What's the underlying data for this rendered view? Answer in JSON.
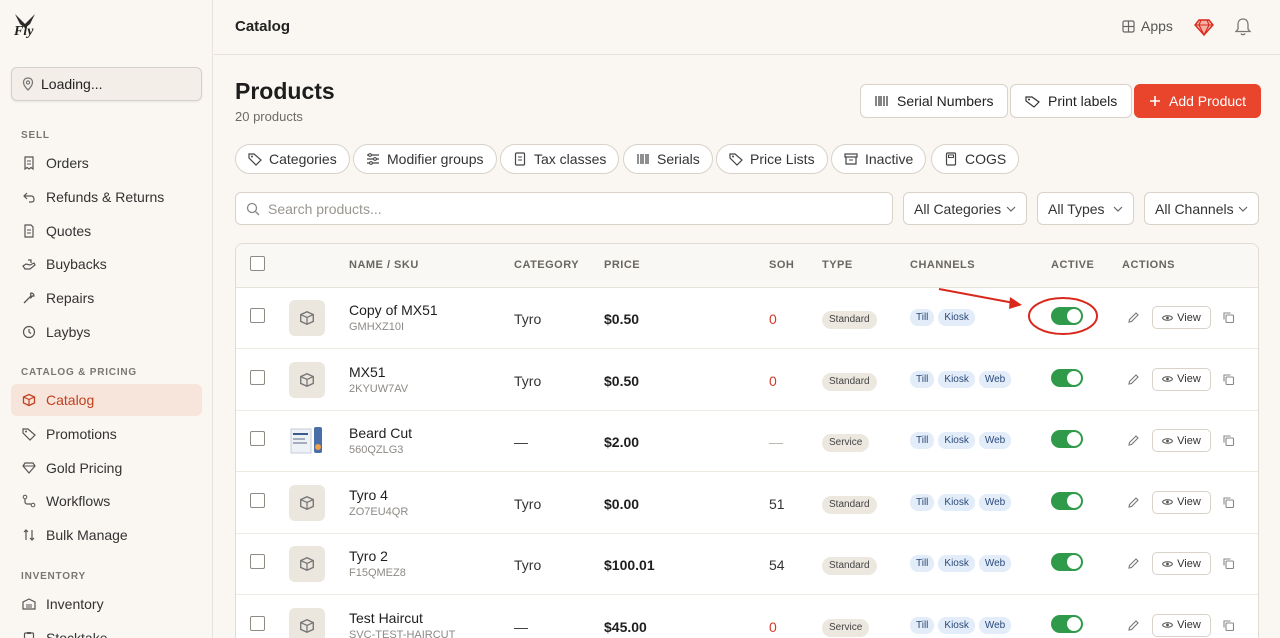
{
  "app": {
    "logo_text": "Fly"
  },
  "sidebar": {
    "location": "Loading...",
    "sections": [
      {
        "label": "SELL",
        "items": [
          {
            "label": "Orders",
            "icon": "receipt-icon"
          },
          {
            "label": "Refunds & Returns",
            "icon": "return-arrow-icon"
          },
          {
            "label": "Quotes",
            "icon": "document-icon"
          },
          {
            "label": "Buybacks",
            "icon": "hand-icon"
          },
          {
            "label": "Repairs",
            "icon": "wrench-icon"
          },
          {
            "label": "Laybys",
            "icon": "clock-icon"
          }
        ]
      },
      {
        "label": "CATALOG & PRICING",
        "items": [
          {
            "label": "Catalog",
            "icon": "box-icon",
            "active": true
          },
          {
            "label": "Promotions",
            "icon": "tag-icon"
          },
          {
            "label": "Gold Pricing",
            "icon": "gem-icon"
          },
          {
            "label": "Workflows",
            "icon": "workflow-icon"
          },
          {
            "label": "Bulk Manage",
            "icon": "sort-arrows-icon"
          }
        ]
      },
      {
        "label": "INVENTORY",
        "items": [
          {
            "label": "Inventory",
            "icon": "warehouse-icon"
          },
          {
            "label": "Stocktake",
            "icon": "clipboard-icon"
          }
        ]
      }
    ]
  },
  "header": {
    "title": "Catalog",
    "apps_label": "Apps"
  },
  "page": {
    "title": "Products",
    "subtitle": "20 products",
    "buttons": {
      "serial_numbers": "Serial Numbers",
      "print_labels": "Print labels",
      "add_product": "Add Product"
    },
    "chips": [
      "Categories",
      "Modifier groups",
      "Tax classes",
      "Serials",
      "Price Lists",
      "Inactive",
      "COGS"
    ],
    "search_placeholder": "Search products...",
    "filters": {
      "categories": "All Categories",
      "types": "All Types",
      "channels": "All Channels"
    }
  },
  "table": {
    "headers": {
      "name": "NAME / SKU",
      "category": "CATEGORY",
      "price": "PRICE",
      "soh": "SOH",
      "type": "TYPE",
      "channels": "CHANNELS",
      "active": "ACTIVE",
      "actions": "ACTIONS"
    },
    "view_label": "View",
    "rows": [
      {
        "name": "Copy of MX51",
        "sku": "GMHXZ10I",
        "category": "Tyro",
        "price": "$0.50",
        "soh": "0",
        "type": "Standard",
        "channels": [
          "Till",
          "Kiosk"
        ],
        "active": true,
        "thumb": "box"
      },
      {
        "name": "MX51",
        "sku": "2KYUW7AV",
        "category": "Tyro",
        "price": "$0.50",
        "soh": "0",
        "type": "Standard",
        "channels": [
          "Till",
          "Kiosk",
          "Web"
        ],
        "active": true,
        "thumb": "box"
      },
      {
        "name": "Beard Cut",
        "sku": "560QZLG3",
        "category": "—",
        "price": "$2.00",
        "soh": "—",
        "type": "Service",
        "channels": [
          "Till",
          "Kiosk",
          "Web"
        ],
        "active": true,
        "thumb": "image"
      },
      {
        "name": "Tyro 4",
        "sku": "ZO7EU4QR",
        "category": "Tyro",
        "price": "$0.00",
        "soh": "51",
        "type": "Standard",
        "channels": [
          "Till",
          "Kiosk",
          "Web"
        ],
        "active": true,
        "thumb": "box"
      },
      {
        "name": "Tyro 2",
        "sku": "F15QMEZ8",
        "category": "Tyro",
        "price": "$100.01",
        "soh": "54",
        "type": "Standard",
        "channels": [
          "Till",
          "Kiosk",
          "Web"
        ],
        "active": true,
        "thumb": "box"
      },
      {
        "name": "Test Haircut",
        "sku": "SVC-TEST-HAIRCUT",
        "category": "—",
        "price": "$45.00",
        "soh": "0",
        "type": "Service",
        "channels": [
          "Till",
          "Kiosk",
          "Web"
        ],
        "active": true,
        "thumb": "box"
      }
    ]
  },
  "colors": {
    "accent": "#e8452c",
    "active_nav_bg": "#f7e5dc",
    "toggle_on": "#2e9a4a",
    "annotation": "#d8291c"
  }
}
